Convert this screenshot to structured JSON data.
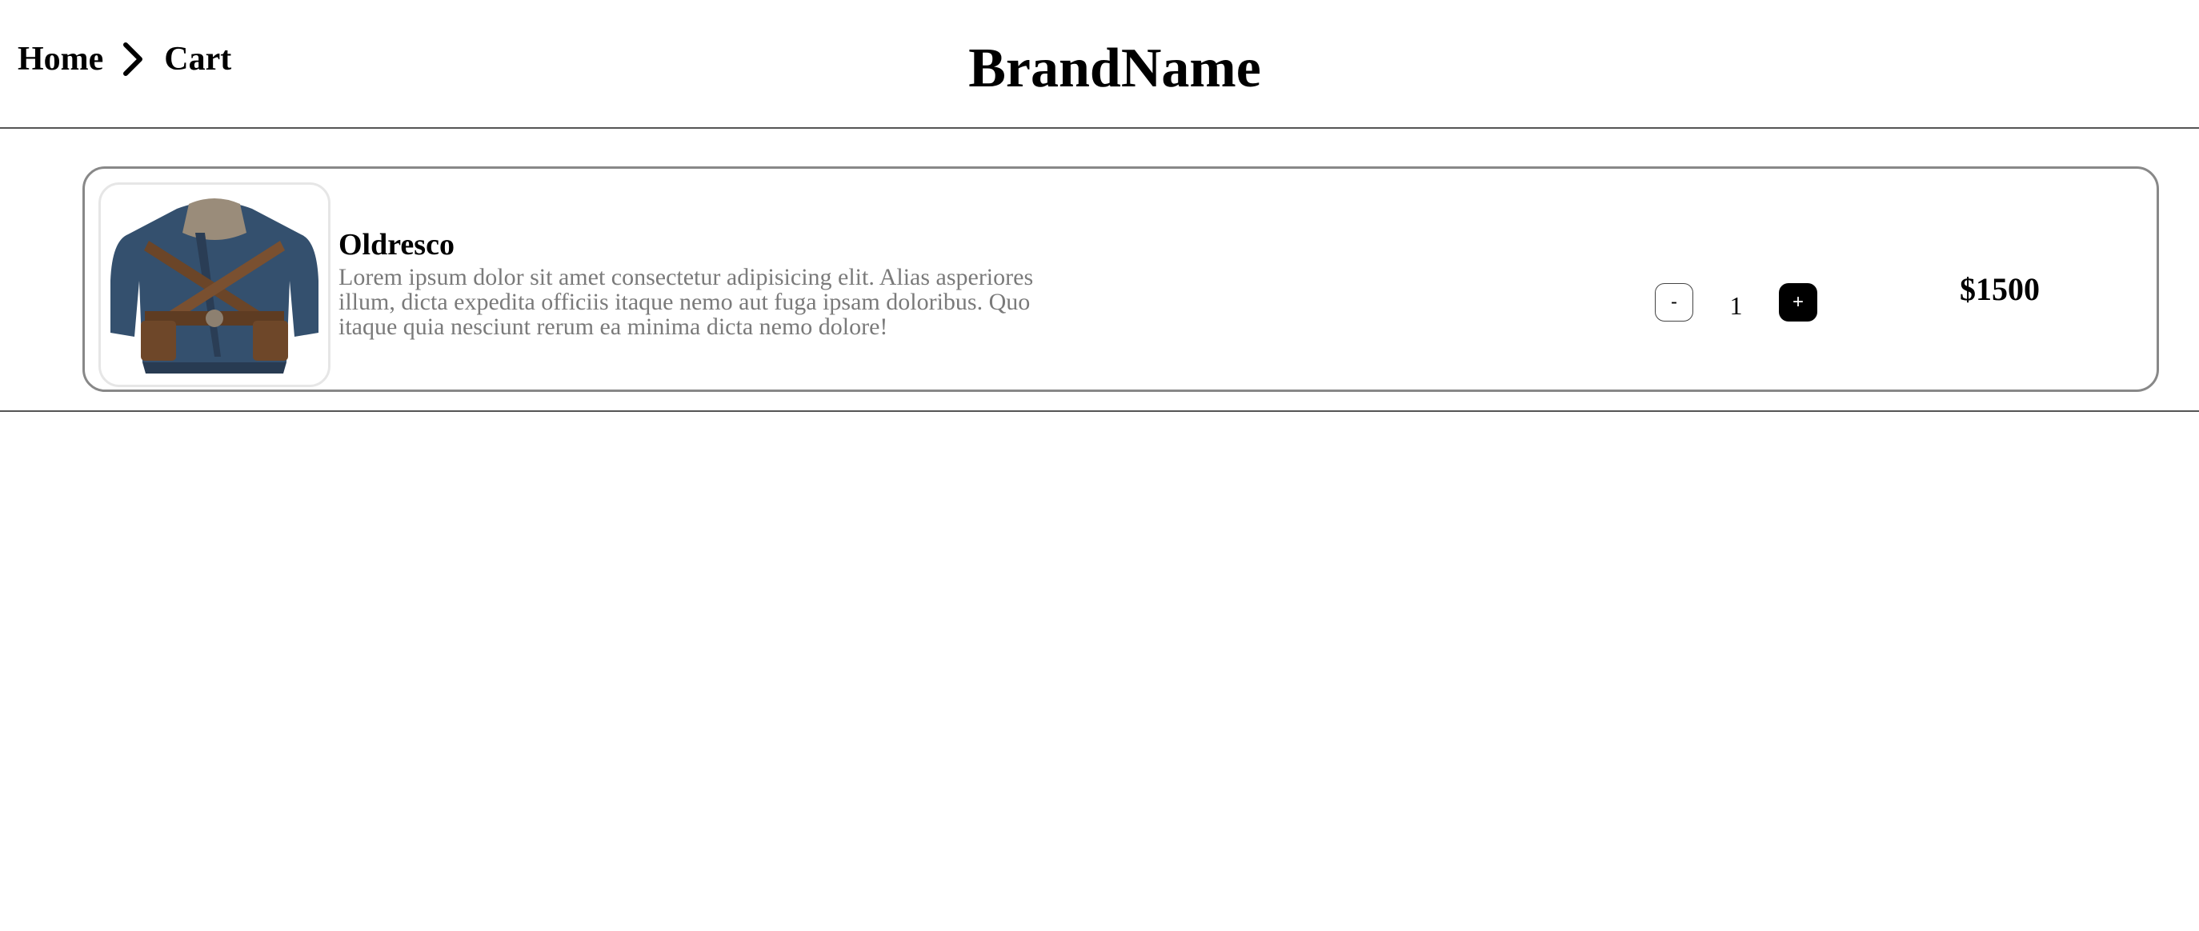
{
  "header": {
    "breadcrumb": {
      "home": "Home",
      "separator_icon": "chevron-right-icon",
      "current": "Cart"
    },
    "brand": "BrandName"
  },
  "cart": {
    "items": [
      {
        "image_icon": "jacket-product-image",
        "name": "Oldresco",
        "description": "Lorem ipsum dolor sit amet consectetur adipisicing elit. Alias asperiores illum, dicta expedita officiis itaque nemo aut fuga ipsam doloribus. Quo itaque quia nesciunt rerum ea minima dicta nemo dolore!",
        "decrement_label": "-",
        "quantity": "1",
        "increment_label": "+",
        "price": "$1500"
      }
    ]
  }
}
